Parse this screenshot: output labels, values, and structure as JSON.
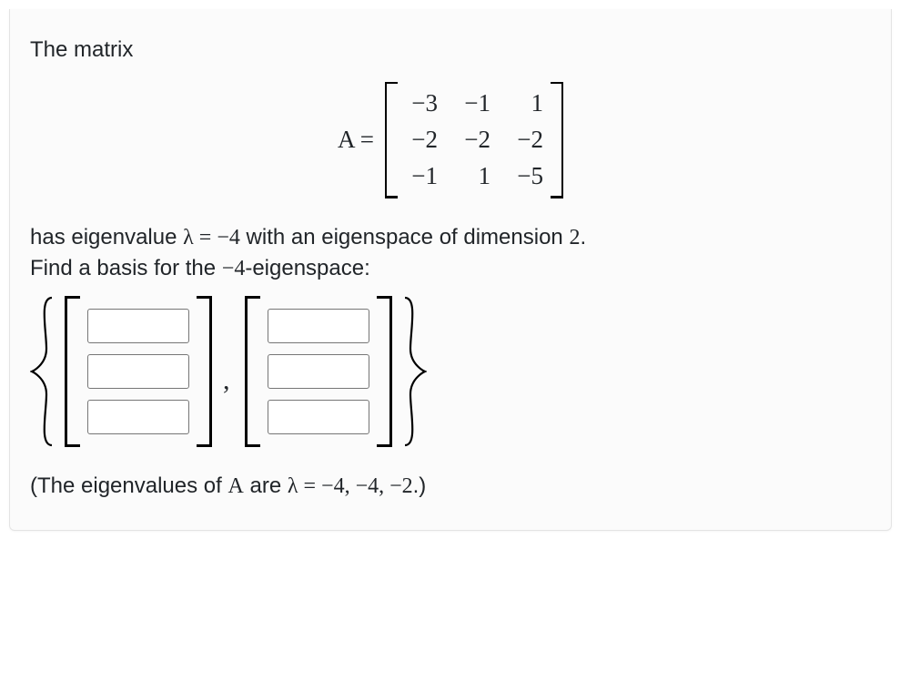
{
  "intro_text": "The matrix",
  "matrix": {
    "label_lhs": "A",
    "equals": " = ",
    "rows": [
      [
        "−3",
        "−1",
        "1"
      ],
      [
        "−2",
        "−2",
        "−2"
      ],
      [
        "−1",
        "1",
        "−5"
      ]
    ]
  },
  "statement": {
    "prefix": "has eigenvalue ",
    "lambda": "λ",
    "eq": " = ",
    "value": "−4",
    "mid": " with an eigenspace of dimension ",
    "dim": "2",
    "period": ".",
    "line2_prefix": "Find a basis for the ",
    "line2_value": "−4",
    "line2_suffix": "-eigenspace:"
  },
  "vectors": {
    "v1": [
      "",
      "",
      ""
    ],
    "v2": [
      "",
      "",
      ""
    ]
  },
  "footer": {
    "open": "(The eigenvalues of ",
    "A": "A",
    "are": " are ",
    "lambda": "λ",
    "eq": " = ",
    "vals": "−4, −4, −2",
    "close": ".)"
  }
}
